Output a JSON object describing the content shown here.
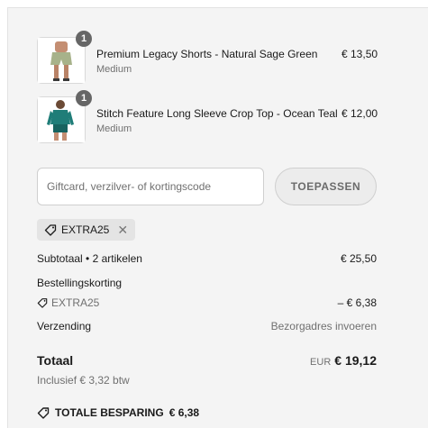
{
  "items": [
    {
      "name": "Premium Legacy Shorts - Natural Sage Green",
      "variant": "Medium",
      "price": "€ 13,50",
      "qty": "1",
      "image": "sage-shorts-product-photo"
    },
    {
      "name": "Stitch Feature Long Sleeve Crop Top - Ocean Teal",
      "variant": "Medium",
      "price": "€ 12,00",
      "qty": "1",
      "image": "teal-crop-top-product-photo"
    }
  ],
  "discount": {
    "placeholder": "Giftcard, verzilver- of kortingscode",
    "apply_label": "TOEPASSEN",
    "applied_code": "EXTRA25",
    "remove_symbol": "✕"
  },
  "summary": {
    "subtotal_label": "Subtotaal • 2 artikelen",
    "subtotal_value": "€ 25,50",
    "discount_label": "Bestellingskorting",
    "discount_code": "EXTRA25",
    "discount_value": "– € 6,38",
    "shipping_label": "Verzending",
    "shipping_value": "Bezorgadres invoeren",
    "total_label": "Totaal",
    "total_currency": "EUR",
    "total_value": "€ 19,12",
    "tax_note": "Inclusief € 3,32 btw",
    "savings_label": "TOTALE BESPARING",
    "savings_value": "€ 6,38"
  },
  "colors": {
    "panel": "#f4f4f4",
    "badge": "#666666",
    "sage": "#a7b28a",
    "teal": "#1f7d78"
  },
  "icons": [
    "tag-icon",
    "close-icon",
    "savings-tag-icon"
  ]
}
